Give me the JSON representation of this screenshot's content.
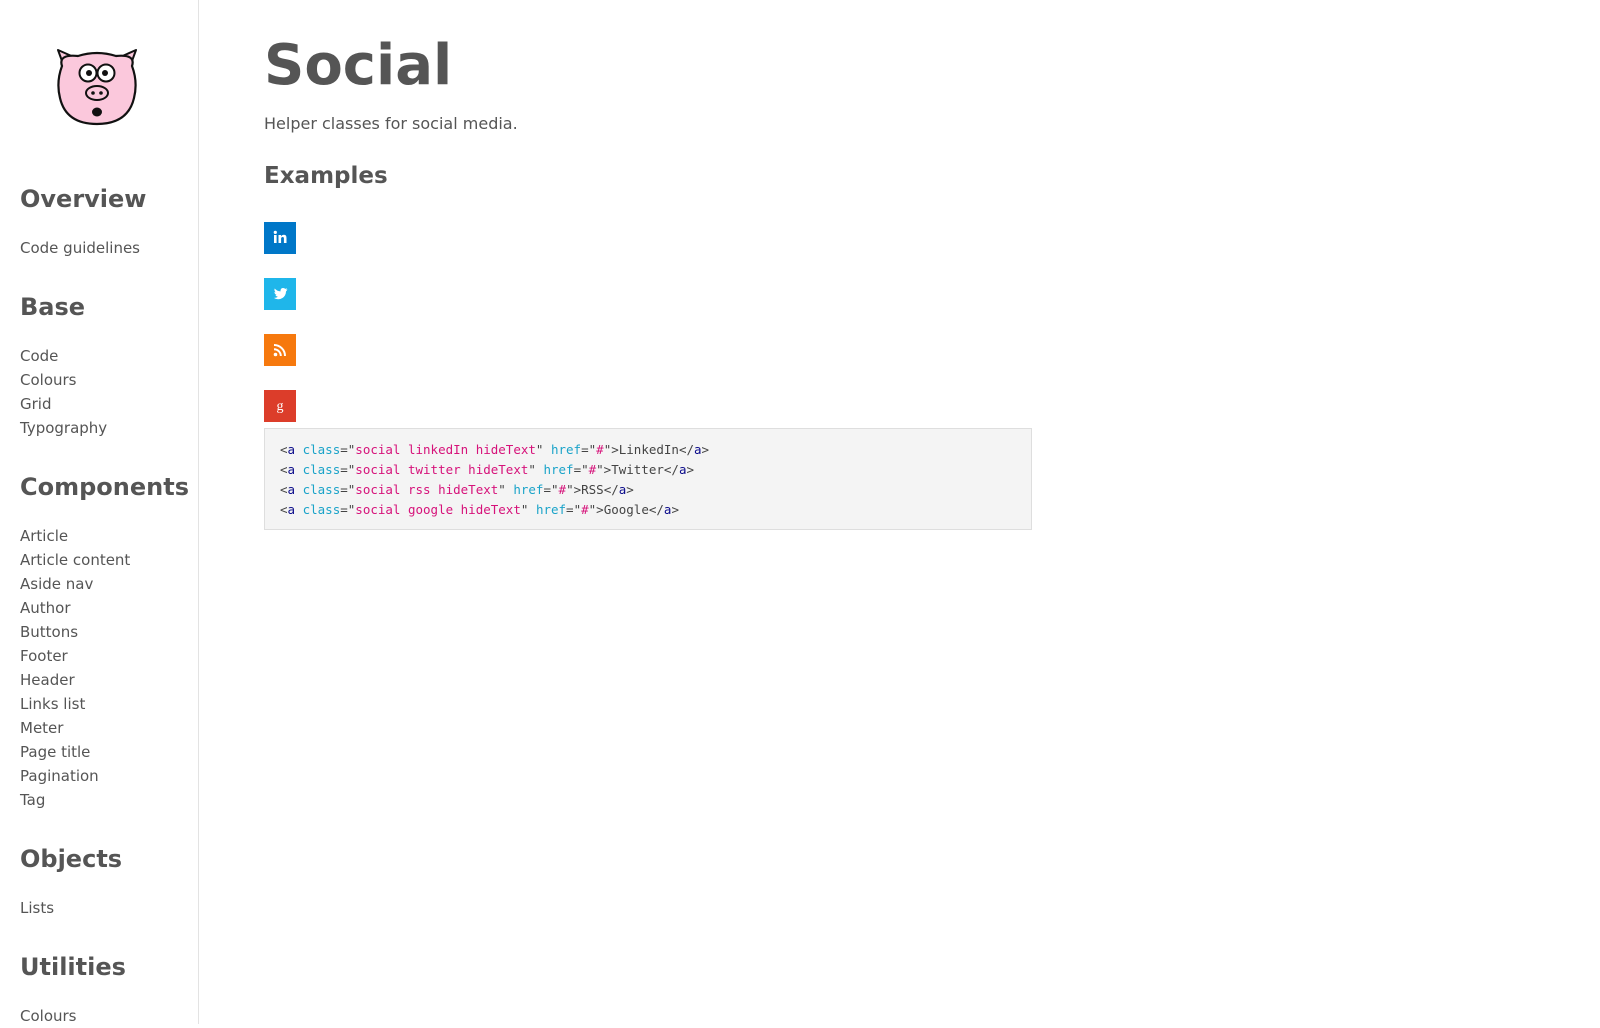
{
  "sidebar": {
    "sections": [
      {
        "heading": "Overview",
        "items": [
          "Code guidelines"
        ]
      },
      {
        "heading": "Base",
        "items": [
          "Code",
          "Colours",
          "Grid",
          "Typography"
        ]
      },
      {
        "heading": "Components",
        "items": [
          "Article",
          "Article content",
          "Aside nav",
          "Author",
          "Buttons",
          "Footer",
          "Header",
          "Links list",
          "Meter",
          "Page title",
          "Pagination",
          "Tag"
        ]
      },
      {
        "heading": "Objects",
        "items": [
          "Lists"
        ]
      },
      {
        "heading": "Utilities",
        "items": [
          "Colours"
        ]
      }
    ]
  },
  "main": {
    "title": "Social",
    "lead": "Helper classes for social media.",
    "examples_heading": "Examples",
    "social_buttons": [
      {
        "name": "linkedin",
        "icon": "linkedin-icon",
        "color": "#0077c8"
      },
      {
        "name": "twitter",
        "icon": "twitter-icon",
        "color": "#1fb6ea"
      },
      {
        "name": "rss",
        "icon": "rss-icon",
        "color": "#f6790e"
      },
      {
        "name": "google",
        "icon": "google-plus-icon",
        "color": "#dc3d2a"
      }
    ],
    "code_lines": [
      {
        "open": "<",
        "tag": "a",
        "attr1": "class",
        "eq1": "=\"",
        "class_value": "social linkedIn hideText",
        "q1": "\" ",
        "attr2": "href",
        "eq2": "=\"",
        "href_value": "#",
        "mid": "\">LinkedIn</",
        "close_tag": "a",
        "end": ">"
      },
      {
        "open": "<",
        "tag": "a",
        "attr1": "class",
        "eq1": "=\"",
        "class_value": "social twitter hideText",
        "q1": "\" ",
        "attr2": "href",
        "eq2": "=\"",
        "href_value": "#",
        "mid": "\">Twitter</",
        "close_tag": "a",
        "end": ">"
      },
      {
        "open": "<",
        "tag": "a",
        "attr1": "class",
        "eq1": "=\"",
        "class_value": "social rss hideText",
        "q1": "\" ",
        "attr2": "href",
        "eq2": "=\"",
        "href_value": "#",
        "mid": "\">RSS</",
        "close_tag": "a",
        "end": ">"
      },
      {
        "open": "<",
        "tag": "a",
        "attr1": "class",
        "eq1": "=\"",
        "class_value": "social google hideText",
        "q1": "\" ",
        "attr2": "href",
        "eq2": "=\"",
        "href_value": "#",
        "mid": "\">Google</",
        "close_tag": "a",
        "end": ">"
      }
    ],
    "colors": {
      "text": "#555555",
      "code_background": "#f4f4f4",
      "code_tag": "#0a0a8a",
      "code_attr": "#1aa3c9",
      "code_value": "#d6127a"
    }
  }
}
